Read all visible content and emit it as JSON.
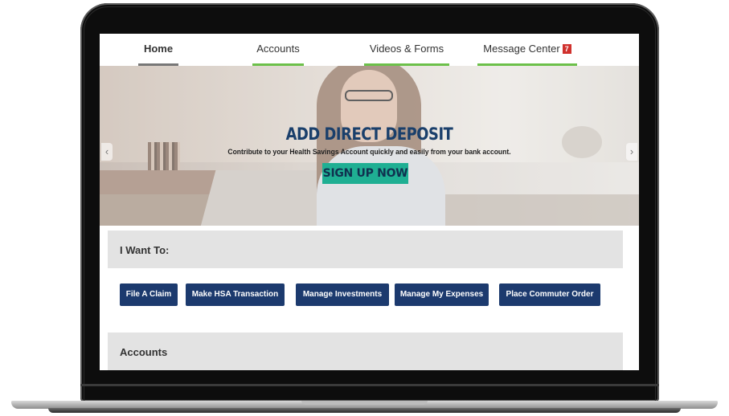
{
  "nav": {
    "home": "Home",
    "accounts": "Accounts",
    "videos": "Videos & Forms",
    "messages": "Message Center",
    "message_count": "7"
  },
  "banner": {
    "title": "ADD DIRECT DEPOSIT",
    "subtitle": "Contribute to your Health Savings Account quickly and easily from your bank account.",
    "cta": "SIGN UP NOW",
    "prev_icon": "chevron-left-icon",
    "next_icon": "chevron-right-icon"
  },
  "i_want_to": {
    "heading": "I Want To:",
    "actions": [
      "File A Claim",
      "Make HSA Transaction",
      "Manage Investments",
      "Manage My Expenses",
      "Place Commuter Order"
    ]
  },
  "accounts": {
    "heading": "Accounts"
  },
  "colors": {
    "nav_accent": "#6cc04a",
    "home_underline": "#777777",
    "badge": "#d0312d",
    "action_button": "#1c3a6e",
    "cta_button": "#1faf93",
    "promo_title": "#1a3f6b",
    "section_bg": "#e3e3e3"
  }
}
